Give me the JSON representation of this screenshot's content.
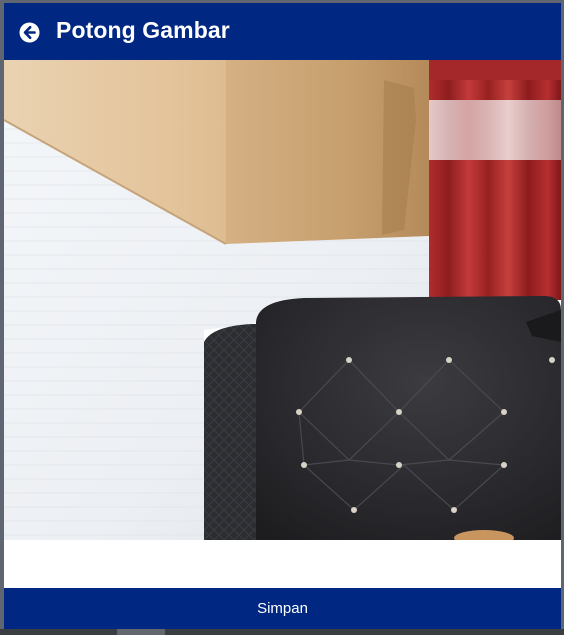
{
  "header": {
    "title": "Potong Gambar",
    "back_icon": "arrow-left-circle-icon",
    "background": "#002882"
  },
  "image": {
    "description_icon": "camera-photo",
    "content": "photo-to-crop"
  },
  "footer": {
    "save_label": "Simpan",
    "background": "#002882"
  }
}
